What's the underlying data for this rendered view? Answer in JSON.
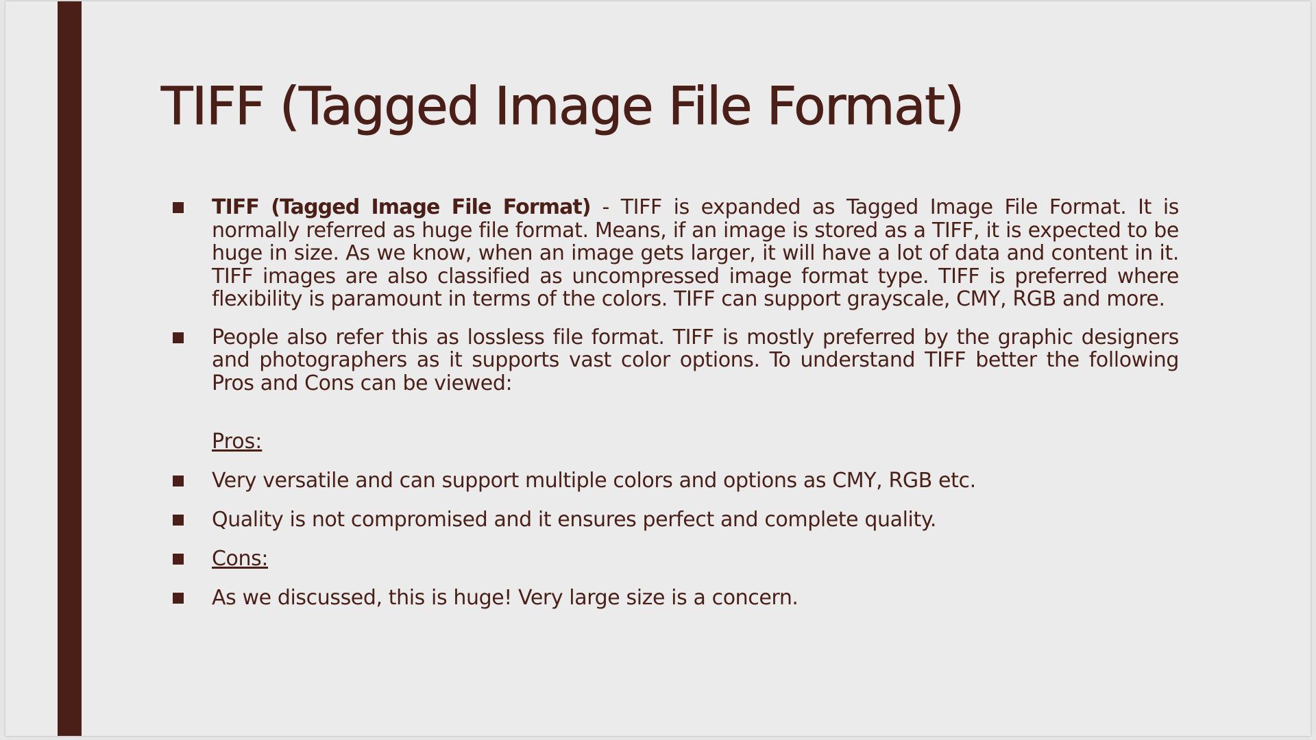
{
  "slide": {
    "title": "TIFF (Tagged Image File Format)",
    "bullets": [
      {
        "lead": "TIFF (Tagged Image File Format)",
        "text": " - TIFF is expanded as Tagged Image File Format. It is normally referred as huge file format. Means, if an image is stored as a TIFF, it is expected to be huge in size. As we know, when an image gets larger, it will have a lot of data and content in it. TIFF images are also classified as uncompressed image format type. TIFF is preferred where flexibility is paramount in terms of the colors.  TIFF can support grayscale, CMY, RGB and more."
      },
      {
        "text": "People also refer this as lossless file format. TIFF is mostly preferred by the graphic designers and photographers as it supports vast color options. To understand TIFF better the following Pros and Cons can be viewed:"
      }
    ],
    "pros_heading": "Pros:",
    "pros": [
      "Very versatile and can support multiple colors and options as CMY, RGB etc.",
      "Quality is not compromised and it ensures perfect and complete quality."
    ],
    "cons_heading": "Cons:",
    "cons": [
      "As we discussed, this is huge! Very large size is a concern."
    ]
  },
  "colors": {
    "accent": "#4a1f18",
    "background": "#ebebeb"
  }
}
